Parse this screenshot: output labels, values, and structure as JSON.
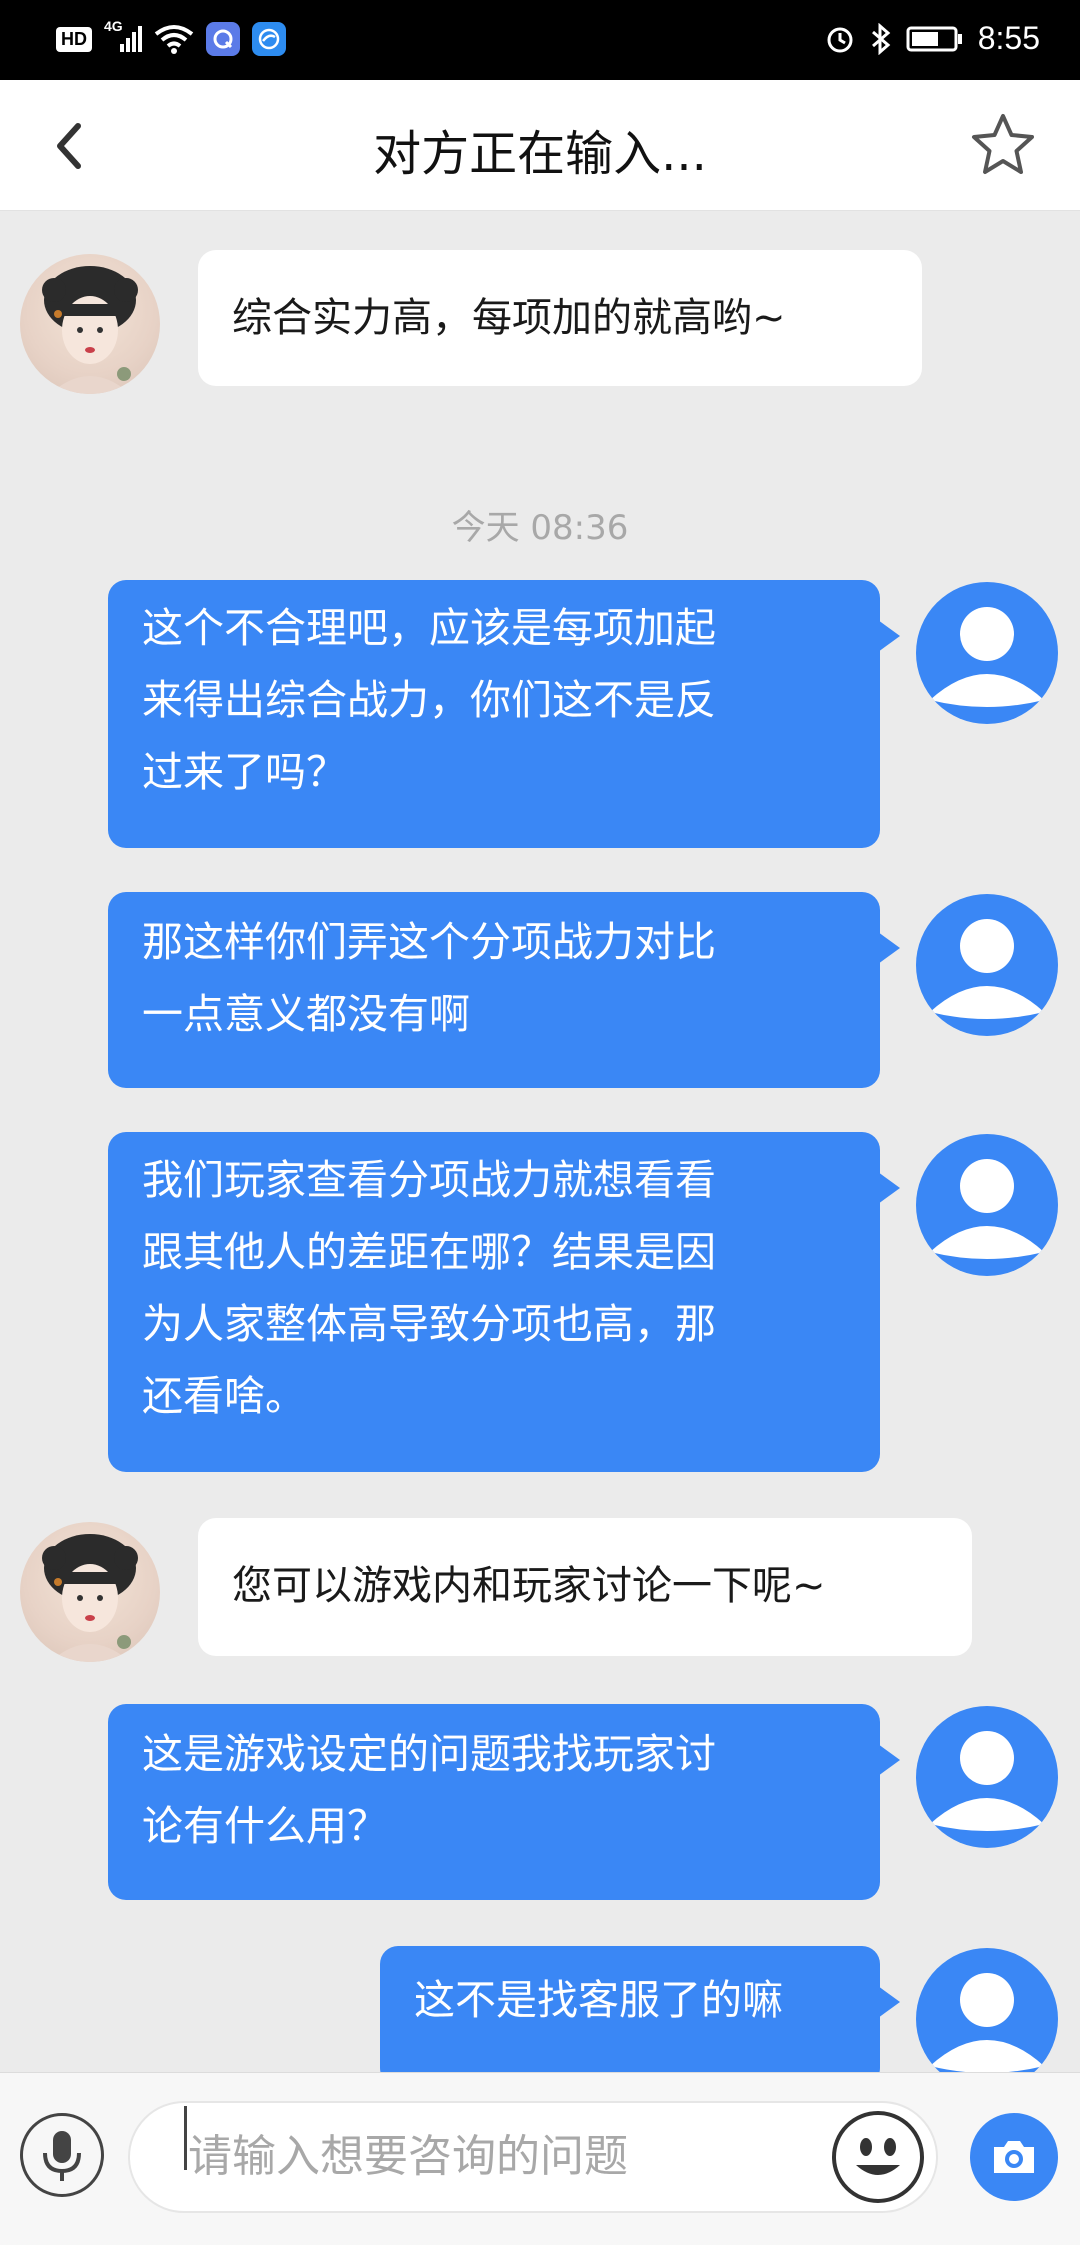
{
  "status_bar": {
    "hd_label": "HD",
    "network_label": "4G",
    "time": "8:55"
  },
  "header": {
    "title": "对方正在输入...",
    "back_icon": "chevron-left-icon",
    "favorite_icon": "star-outline-icon"
  },
  "chat": {
    "timestamp": "今天 08:36",
    "messages": [
      {
        "sender": "agent",
        "lines": [
          "综合实力高，每项加的就高哟~"
        ]
      },
      {
        "sender": "user",
        "lines": [
          "这个不合理吧，应该是每项加起",
          "来得出综合战力，你们这不是反",
          "过来了吗？"
        ]
      },
      {
        "sender": "user",
        "lines": [
          "那这样你们弄这个分项战力对比",
          "一点意义都没有啊"
        ]
      },
      {
        "sender": "user",
        "lines": [
          "我们玩家查看分项战力就想看看",
          "跟其他人的差距在哪？结果是因",
          "为人家整体高导致分项也高，那",
          "还看啥。"
        ]
      },
      {
        "sender": "agent",
        "lines": [
          "您可以游戏内和玩家讨论一下呢~"
        ]
      },
      {
        "sender": "user",
        "lines": [
          "这是游戏设定的问题我找玩家讨",
          "论有什么用？"
        ]
      },
      {
        "sender": "user",
        "lines": [
          "这不是找客服了的嘛"
        ]
      }
    ]
  },
  "input_bar": {
    "placeholder": "请输入想要咨询的问题",
    "mic_icon": "microphone-icon",
    "emoji_icon": "emoji-icon",
    "camera_icon": "camera-icon"
  },
  "colors": {
    "accent": "#3a87f5",
    "background": "#ebebeb",
    "agent_bubble": "#ffffff"
  }
}
